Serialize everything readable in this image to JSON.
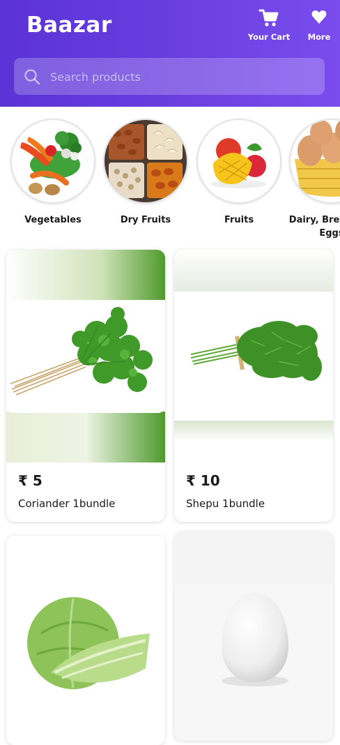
{
  "app": {
    "title": "Baazar"
  },
  "header": {
    "cart_label": "Your Cart",
    "cart_icon": "cart-icon",
    "more_label": "More",
    "more_icon": "heart-icon"
  },
  "search": {
    "placeholder": "Search products",
    "value": ""
  },
  "categories": [
    {
      "label": "Vegetables"
    },
    {
      "label": "Dry Fruits"
    },
    {
      "label": "Fruits"
    },
    {
      "label": "Dairy, Bread and Eggs"
    }
  ],
  "products": [
    {
      "price": "₹ 5",
      "name": "Coriander 1bundle"
    },
    {
      "price": "₹ 10",
      "name": "Shepu 1bundle"
    },
    {
      "price": "",
      "name": ""
    },
    {
      "price": "",
      "name": ""
    }
  ],
  "colors": {
    "header_start": "#5a33d6",
    "header_end": "#7a4cee",
    "text": "#1a1a1a"
  }
}
